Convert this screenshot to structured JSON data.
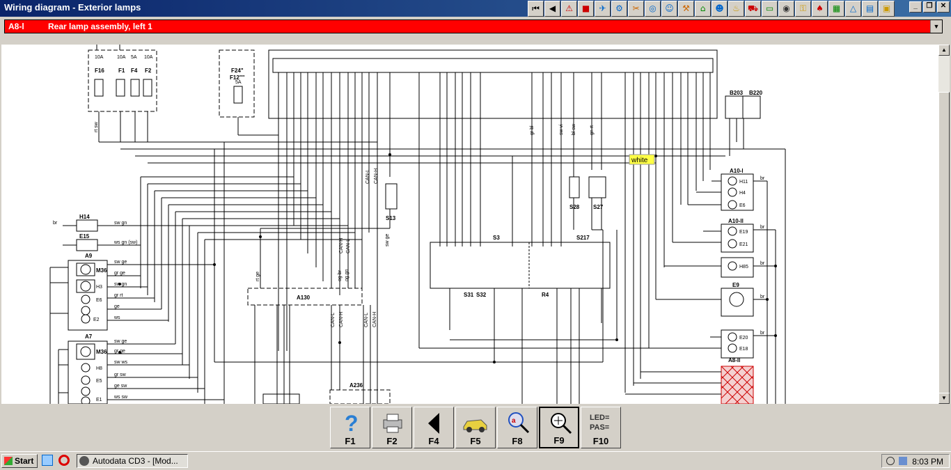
{
  "window": {
    "title": "Wiring diagram - Exterior lamps"
  },
  "component_bar": {
    "code": "A8-l",
    "name": "Rear lamp assembly, left 1"
  },
  "fkeys": [
    {
      "label": "F1",
      "icon": "help-icon"
    },
    {
      "label": "F2",
      "icon": "printer-icon"
    },
    {
      "label": "F4",
      "icon": "back-icon"
    },
    {
      "label": "F5",
      "icon": "car-icon"
    },
    {
      "label": "F8",
      "icon": "zoom-component-icon"
    },
    {
      "label": "F9",
      "icon": "zoom-diagram-icon"
    },
    {
      "label": "F10",
      "icon": "led-pas-icon",
      "text1": "LED=",
      "text2": "PAS="
    }
  ],
  "taskbar": {
    "start": "Start",
    "task": "Autodata CD3 - [Mod...",
    "clock": "8:03 PM"
  },
  "diagram": {
    "components": {
      "F16": "F16",
      "F1": "F1",
      "F4": "F4",
      "F2": "F2",
      "F16_rating": "10A",
      "F1_rating": "10A",
      "F4_rating": "5A",
      "F2_rating": "10A",
      "F24": "F24\"",
      "F12": "F12\"\"",
      "F24_rating": "5A",
      "B203": "B203",
      "B220": "B220",
      "A10l": "A10-l",
      "A10ll": "A10-ll",
      "A8ll": "A8-ll",
      "E9": "E9",
      "H14": "H14",
      "E15": "E15",
      "A9": "A9",
      "A7": "A7",
      "A130": "A130",
      "A236": "A236",
      "S13": "S13",
      "S28": "S28",
      "S27": "S27",
      "S3": "S3",
      "S217": "S217",
      "S31": "S31",
      "S32": "S32",
      "R4": "R4",
      "M36_a": "M36",
      "M36_b": "M36",
      "H11": "H11",
      "H4": "H4",
      "E6_r": "E6",
      "E19": "E19",
      "E21": "E21",
      "H85": "H85",
      "E20": "E20",
      "E18": "E18",
      "H3": "H3",
      "E6_l": "E6",
      "E2": "E2",
      "H8": "H8",
      "E5": "E5",
      "E1": "E1"
    },
    "highlight_label": "white",
    "wire_labels": {
      "sw_gn": "sw gn",
      "ws_gn_sw": "ws gn (sw)",
      "sw_ge": "sw ge",
      "gr_ge": "gr ge",
      "sw_gn2": "sw gn",
      "gr_rt": "gr rt",
      "ge": "ge",
      "ws": "ws",
      "sw_ge2": "sw ge",
      "gr_ge2": "gr ge",
      "sw_ws": "sw ws",
      "gr_sw": "gr sw",
      "ge_sw": "ge sw",
      "ws_sw": "ws sw",
      "br": "br",
      "can_l": "CAN-L",
      "can_h": "CAN-H",
      "rt_sw": "rt sw",
      "sw_vi": "sw vi",
      "gr_bl": "gr bl",
      "bl_sw": "bl sw",
      "gn_rt": "gn rt",
      "og_br": "og br",
      "og_gn": "og gn",
      "rt_ge": "rt ge",
      "sw_ge3": "sw ge"
    }
  }
}
